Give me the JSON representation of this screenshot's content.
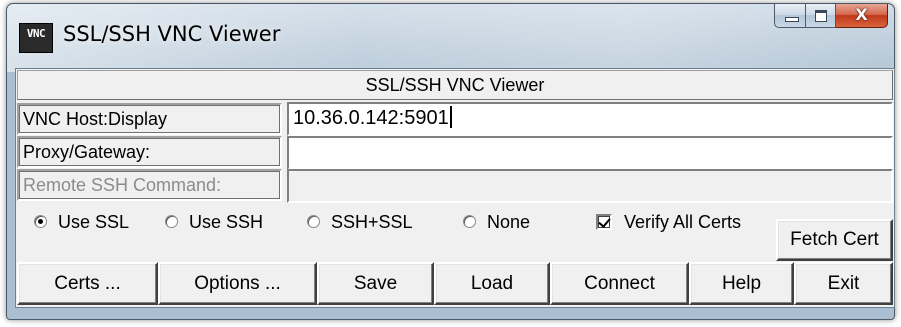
{
  "window": {
    "title": "SSL/SSH VNC Viewer",
    "icon_text_small": "VNC",
    "caption": {
      "minimize": "minimize",
      "maximize": "maximize",
      "close_glyph": "X"
    }
  },
  "banner": "SSL/SSH VNC Viewer",
  "fields": {
    "host": {
      "label": "VNC Host:Display",
      "value": "10.36.0.142:5901"
    },
    "proxy": {
      "label": "Proxy/Gateway:",
      "value": ""
    },
    "ssh_command": {
      "label": "Remote SSH Command:",
      "value": "",
      "disabled": true
    }
  },
  "mode": {
    "options": [
      {
        "label": "Use SSL",
        "selected": true
      },
      {
        "label": "Use SSH",
        "selected": false
      },
      {
        "label": "SSH+SSL",
        "selected": false
      },
      {
        "label": "None",
        "selected": false
      }
    ]
  },
  "verify_all_certs": {
    "label": "Verify All Certs",
    "checked": true
  },
  "buttons": {
    "fetch_cert": "Fetch Cert",
    "certs": "Certs ...",
    "options": "Options ...",
    "save": "Save",
    "load": "Load",
    "connect": "Connect",
    "help": "Help",
    "exit": "Exit"
  },
  "colors": {
    "window_frame": "#b9cad9",
    "dialog_bg": "#f0f0f0",
    "close_button": "#c0391a"
  }
}
